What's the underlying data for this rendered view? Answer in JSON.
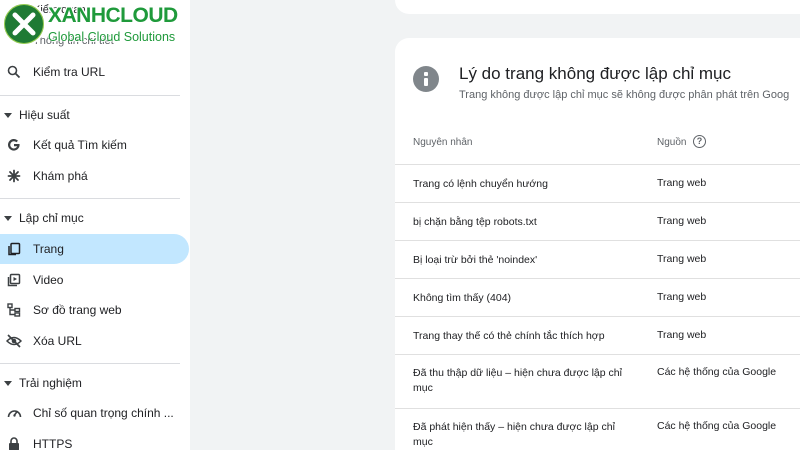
{
  "logo": {
    "name": "XANHCLOUD",
    "tagline": "Global Cloud Solutions",
    "faded_top": "Kiểm quan",
    "faded_second": "Thông tin chi tiết"
  },
  "sidebar": {
    "url_inspection": "Kiểm tra URL",
    "sections": {
      "performance": "Hiệu suất",
      "indexing": "Lập chỉ mục",
      "experience": "Trải nghiệm"
    },
    "items": {
      "search_results": "Kết quả Tìm kiếm",
      "discover": "Khám phá",
      "pages": "Trang",
      "video": "Video",
      "sitemaps": "Sơ đồ trang web",
      "removals": "Xóa URL",
      "core_web_vitals": "Chỉ số quan trọng chính ...",
      "https": "HTTPS"
    }
  },
  "main": {
    "title": "Lý do trang không được lập chỉ mục",
    "subtitle": "Trang không được lập chỉ mục sẽ không được phân phát trên Goog",
    "columns": {
      "reason": "Nguyên nhân",
      "source": "Nguồn"
    },
    "rows": [
      {
        "reason": "Trang có lệnh chuyển hướng",
        "source": "Trang web"
      },
      {
        "reason": "bị chặn bằng tệp robots.txt",
        "source": "Trang web"
      },
      {
        "reason": "Bị loại trừ bởi thẻ 'noindex'",
        "source": "Trang web"
      },
      {
        "reason": "Không tìm thấy (404)",
        "source": "Trang web"
      },
      {
        "reason": "Trang thay thế có thẻ chính tắc thích hợp",
        "source": "Trang web"
      },
      {
        "reason": "Đã thu thập dữ liệu – hiện chưa được lập chỉ mục",
        "source": "Các hệ thống của Google"
      },
      {
        "reason": "Đã phát hiện thấy – hiện chưa được lập chỉ mục",
        "source": "Các hệ thống của Google"
      }
    ]
  },
  "colors": {
    "active_nav": "#c2e7ff",
    "brand_green": "#1f9a3b",
    "page_bg": "#f1f3f4"
  }
}
